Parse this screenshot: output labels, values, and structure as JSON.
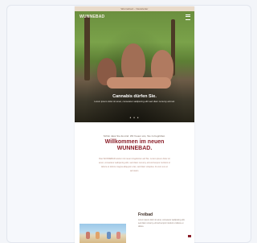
{
  "newsletter": {
    "topbar_text": "Wunnebad – Newsletter",
    "brand": "WUNNEBAD",
    "hero_caption": "Cannabis dürfen Sie.",
    "hero_subcaption": "Lorem ipsum dolor sit amet, consetetur sadipscing elitr sed diam nonumy eirmod.",
    "hero_dots": "● ● ●",
    "eyebrow": "Schön dass Sie da sind. Wir freuen uns, Sie zu begrüßen.",
    "headline_line1": "Willkommen im neuen",
    "headline_line2": "WUNNEBAD.",
    "body": "Das WUNNEBAD wartet mit neuen Angeboten auf Sie. Lorem ipsum dolor sit amet, consetetur sadipscing elitr, sed diam nonumy eirmod tempor invidunt ut labore et dolore magna aliquyam erat, sed diam voluptua. At vero eos et accusam.",
    "section_title": "Freibad",
    "section_text": "Lorem ipsum dolor sit amet, consetetur sadipscing elitr, sed diam nonumy eirmod tempor invidunt ut labore et dolore."
  },
  "colors": {
    "accent": "#8b1f2a",
    "page_bg": "#f3f5f9"
  }
}
